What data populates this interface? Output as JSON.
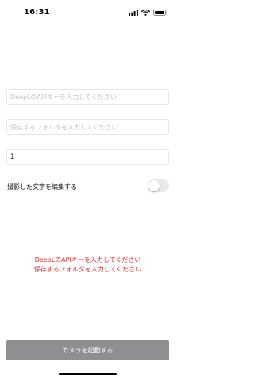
{
  "status_bar": {
    "time": "16:31",
    "icons": [
      "signal-icon",
      "wifi-icon",
      "battery-icon"
    ]
  },
  "form": {
    "api_key": {
      "value": "",
      "placeholder": "DeepLのAPIキーを入力してください"
    },
    "folder": {
      "value": "",
      "placeholder": "保存するフォルダを入力してください"
    },
    "count": {
      "value": "1"
    },
    "edit_toggle": {
      "label": "撮影した文字を編集する",
      "on": false
    }
  },
  "errors": [
    "DeepLのAPIキーを入力してください",
    "保存するフォルダを入力してください"
  ],
  "camera_button": {
    "label": "カメラを起動する"
  },
  "colors": {
    "error": "#e5322d",
    "button_bg": "#8e8e93",
    "toggle_off": "#e9e9eb"
  }
}
